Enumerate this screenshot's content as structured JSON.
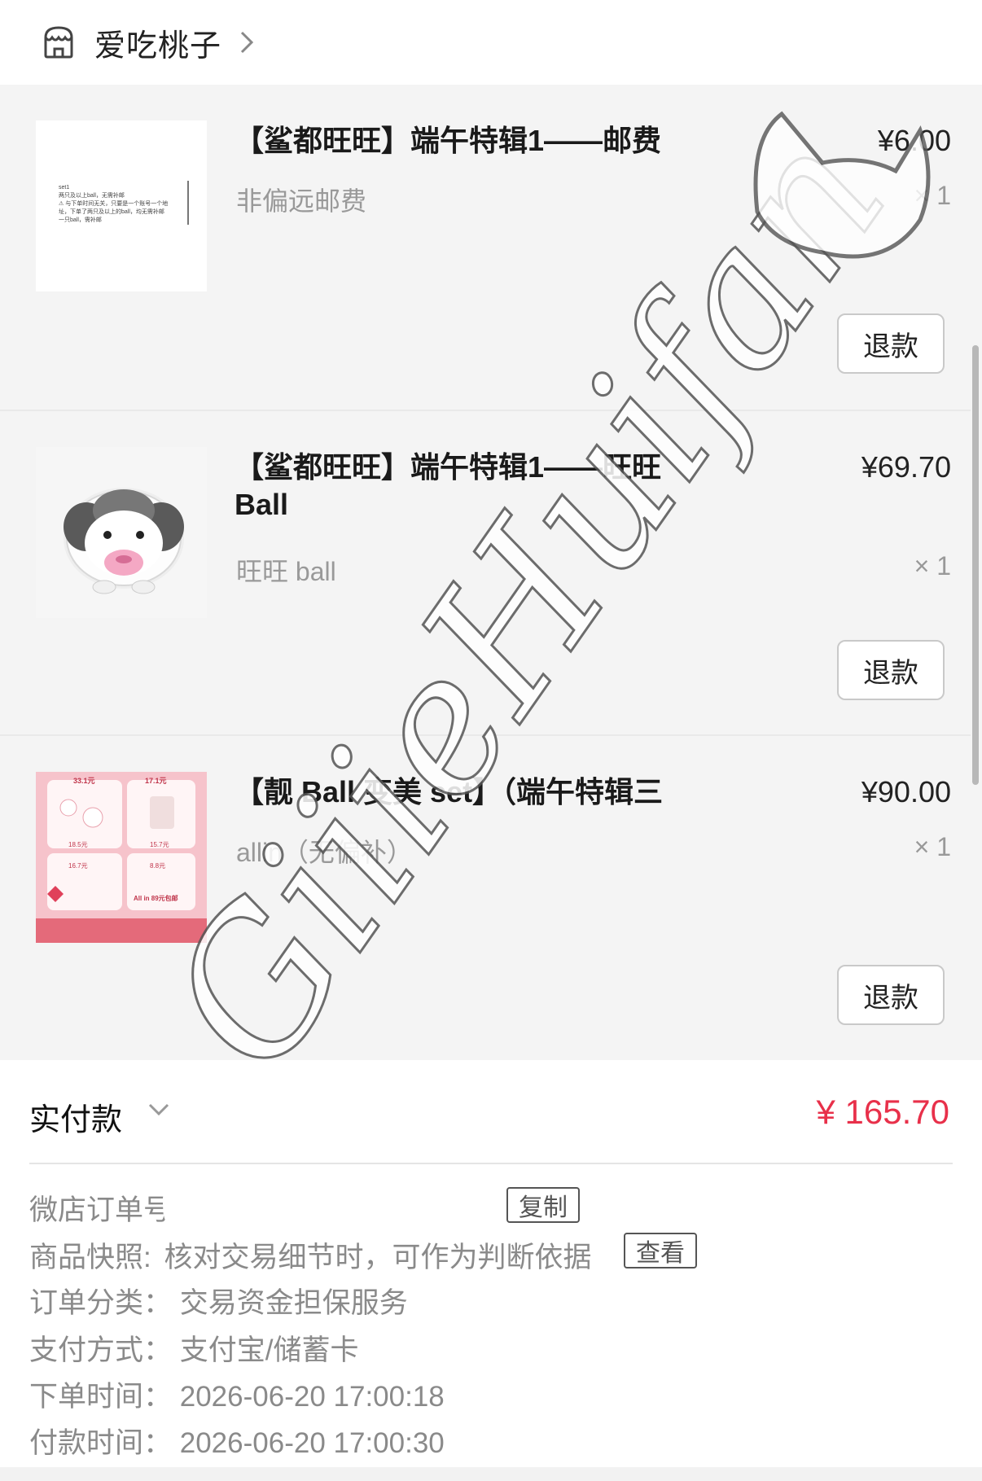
{
  "shop": {
    "name": "爱吃桃子",
    "icon": "shop-icon"
  },
  "items": [
    {
      "title": "【鲨都旺旺】端午特辑1——邮费",
      "spec": "非偏远邮费",
      "price": "¥6.00",
      "qty": "× 1",
      "refund_label": "退款",
      "thumb_text": [
        "set1",
        "两只及以上ball，无需补邮",
        "⚠ 与下单时间无关，只要是一个账号一个地址，下单了两只及以上的ball，均无需补邮",
        "一只ball，需补邮"
      ]
    },
    {
      "title": "【鲨都旺旺】端午特辑1——旺旺 Ball",
      "spec": "旺旺 ball",
      "price": "¥69.70",
      "qty": "× 1",
      "refund_label": "退款"
    },
    {
      "title": "【靓 Ball 变美 set】（端午特辑三",
      "spec": "allin（无偏补）",
      "price": "¥90.00",
      "qty": "× 1",
      "refund_label": "退款",
      "thumb_prices": [
        "33.1元",
        "17.1元",
        "18.5元",
        "15.7元",
        "16.7元",
        "8.8元"
      ],
      "thumb_caption": "All in 89元包邮"
    }
  ],
  "payment": {
    "label": "实付款",
    "amount": "¥ 165.70"
  },
  "order_info": {
    "order_no_label": "微店订单号",
    "copy_label": "复制",
    "snapshot_label": "商品快照:",
    "snapshot_text": "核对交易细节时，可作为判断依据",
    "view_label": "查看",
    "category_label": "订单分类：",
    "category_value": "交易资金担保服务",
    "pay_method_label": "支付方式：",
    "pay_method_value": "支付宝/储蓄卡",
    "order_time_label": "下单时间：",
    "order_time_value": "2026-06-20 17:00:18",
    "pay_time_label": "付款时间：",
    "pay_time_value": "2026-06-20 17:00:30"
  },
  "watermark": {
    "text": "GiiieHuifan"
  },
  "colors": {
    "price_red": "#e8304a",
    "secondary_text": "#8a8a8a",
    "item_bg": "#f4f4f4"
  }
}
